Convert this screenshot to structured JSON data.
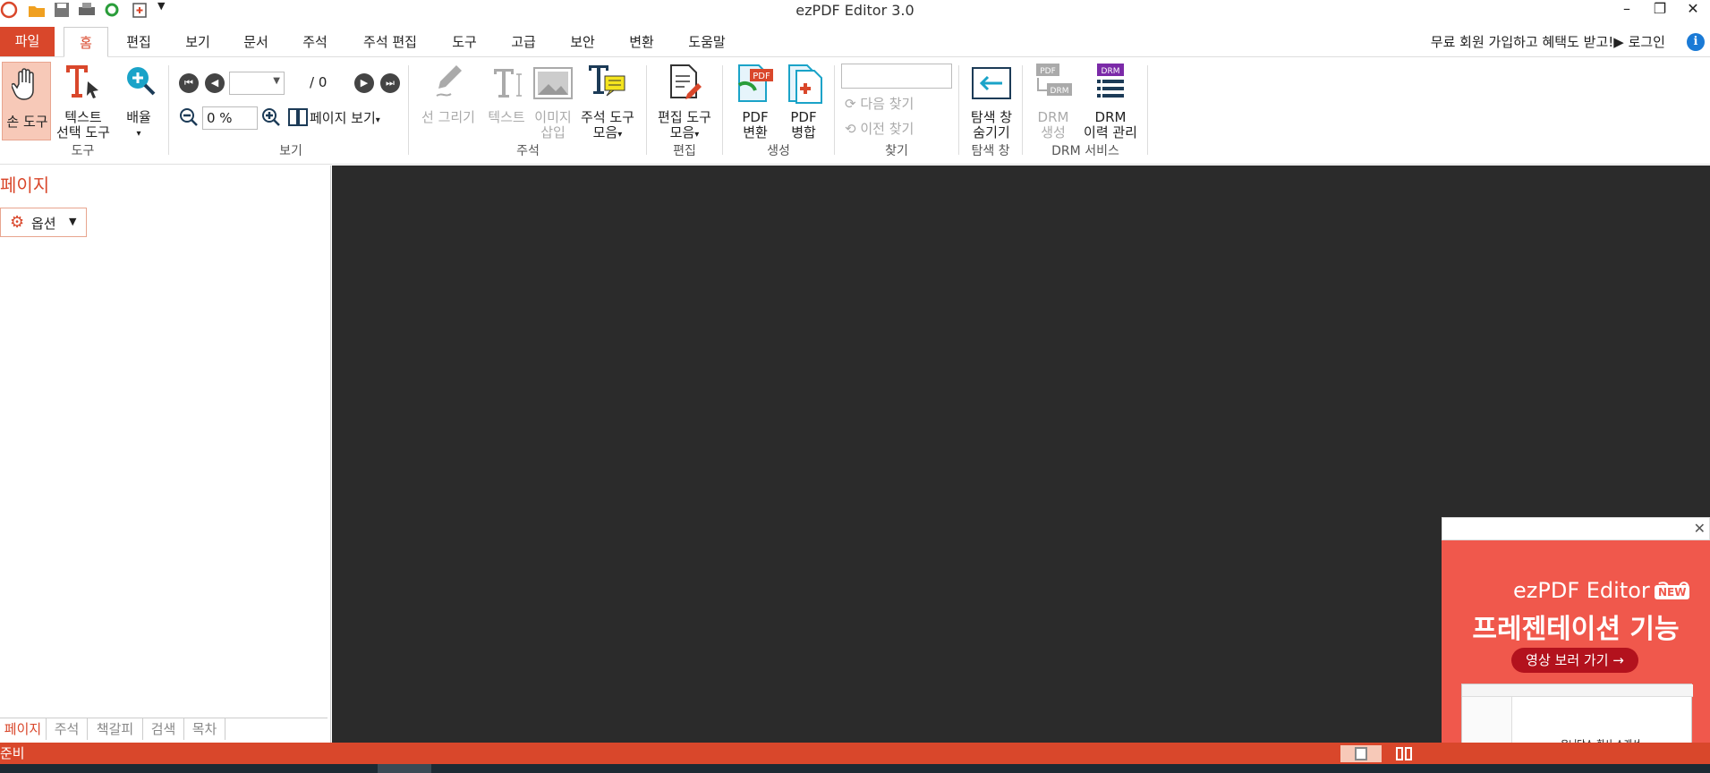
{
  "title": "ezPDF Editor 3.0",
  "file_tab": "파일",
  "tabs": [
    "홈",
    "편집",
    "보기",
    "문서",
    "주석",
    "주석 편집",
    "도구",
    "고급",
    "보안",
    "변환",
    "도움말"
  ],
  "promo": "무료 회원 가입하고 혜택도 받고!▶ 로그인",
  "ribbon": {
    "hand_tool": "손 도구",
    "text_select_1": "텍스트",
    "text_select_2": "선택 도구",
    "zoom_1": "배율",
    "tools_group": "도구",
    "page_total": "/ 0",
    "zoom_value": "0 %",
    "page_view": "페이지 보기",
    "view_group": "보기",
    "draw_line": "선 그리기",
    "text": "텍스트",
    "image_1": "이미지",
    "image_2": "삽입",
    "annot_tools_1": "주석 도구",
    "annot_tools_2": "모음",
    "annot_group": "주석",
    "edit_tools_1": "편집 도구",
    "edit_tools_2": "모음",
    "edit_group": "편집",
    "pdf_convert_1": "PDF",
    "pdf_convert_2": "변환",
    "pdf_merge_1": "PDF",
    "pdf_merge_2": "병합",
    "create_group": "생성",
    "find_next": "다음 찾기",
    "find_prev": "이전 찾기",
    "find_group": "찾기",
    "nav_hide_1": "탐색 창",
    "nav_hide_2": "숨기기",
    "nav_group": "탐색 창",
    "drm_create_1": "DRM",
    "drm_create_2": "생성",
    "drm_history_1": "DRM",
    "drm_history_2": "이력 관리",
    "drm_group": "DRM 서비스"
  },
  "left_panel": {
    "title": "페이지",
    "options": "옵션",
    "bottom_tabs": [
      "페이지",
      "주석",
      "책갈피",
      "검색",
      "목차"
    ]
  },
  "status": "준비",
  "ad": {
    "brand": "ezPDF Editor 3.0",
    "new_badge": "NEW",
    "headline": "프레젠테이션 기능",
    "button": "영상 보러 가기 →",
    "shot_caption": "유니닥스 회사 소개서"
  },
  "colors": {
    "accent": "#d9472b",
    "doc_bg": "#2b2b2b",
    "ad_bg": "#f0584c"
  }
}
